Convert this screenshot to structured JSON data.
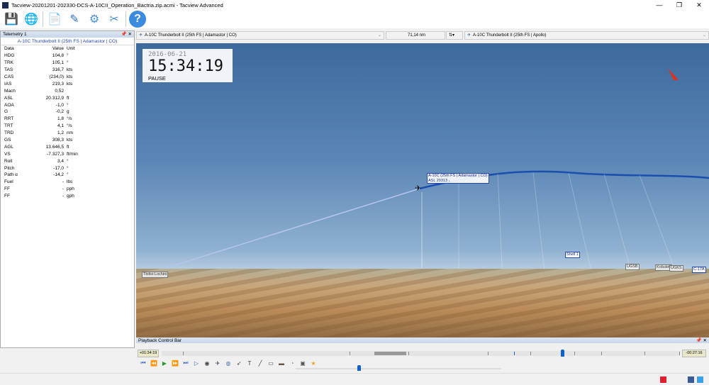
{
  "window": {
    "title": "Tacview-20201201-202330-DCS-A-10CII_Operation_Bactria.zip.acmi - Tacview Advanced",
    "min": "—",
    "restore": "❐",
    "close": "✕"
  },
  "toolbar": [
    {
      "name": "load-icon",
      "glyph": "💾"
    },
    {
      "name": "online-icon",
      "glyph": "🌐"
    },
    {
      "name": "report-icon",
      "glyph": "📄"
    },
    {
      "name": "edit-icon",
      "glyph": "✎"
    },
    {
      "name": "settings-icon",
      "glyph": "⚙"
    },
    {
      "name": "tools-icon",
      "glyph": "✂"
    },
    {
      "name": "help-icon",
      "glyph": "?"
    }
  ],
  "telemetry": {
    "title": "Telemetry 1",
    "aircraft": "A-10C Thunderbolt II (25th FS | Adamastor | CO)",
    "headers": [
      "Data",
      "Value",
      "Unit"
    ],
    "rows": [
      [
        "HDG",
        "104,8",
        "°"
      ],
      [
        "TRK",
        "105,1",
        "°"
      ],
      [
        "TAS",
        "316,7",
        "kts"
      ],
      [
        "CAS",
        "(234,0)",
        "kts"
      ],
      [
        "IAS",
        "219,3",
        "kts"
      ],
      [
        "Mach",
        "0,52",
        ""
      ],
      [
        "ASL",
        "20.312,9",
        "ft"
      ],
      [
        "AOA",
        "-1,0",
        "°"
      ],
      [
        "G",
        "-0,2",
        "g"
      ],
      [
        "RRT",
        "1,8",
        "°/s"
      ],
      [
        "TRT",
        "4,1",
        "°/s"
      ],
      [
        "TRD",
        "1,2",
        "nm"
      ],
      [
        "GS",
        "308,3",
        "kts"
      ],
      [
        "AGL",
        "13.646,5",
        "ft"
      ],
      [
        "VS",
        "-7.327,3",
        "ft/min"
      ],
      [
        "Roll",
        "3,4",
        "°"
      ],
      [
        "Pitch",
        "-17,0",
        "°"
      ],
      [
        "Path α",
        "-14,2",
        "°"
      ],
      [
        "Fuel",
        "-",
        "lbs"
      ],
      [
        "FF",
        "-",
        "pph"
      ],
      [
        "FF",
        "-",
        "gph"
      ]
    ]
  },
  "selectors": {
    "primary": "A-10C Thunderbolt II (25th FS | Adamastor | CO)",
    "distance": "71,14 nm",
    "secondary": "A-10C Thunderbolt II (25th FS | Apollo)"
  },
  "clock": {
    "date": "2016-06-21",
    "time": "15:34:19",
    "status": "PAUSE"
  },
  "labels": {
    "main_line1": "A-10C (25th FS | Adamastor | CO)",
    "main_line2": "ASL 20313 ↓",
    "shell": "Shell 1",
    "ugsb": "UGSB",
    "kobuleti": "Kobuleti",
    "ugks": "UGKS",
    "c17": "C-17A",
    "tbilisi": "Tbilisi-Lochini"
  },
  "playback": {
    "title": "Playback Control Bar",
    "elapsed": "+01:34:19",
    "remaining": "-00:27:16",
    "progress": 0.77,
    "speed": 0.3
  }
}
